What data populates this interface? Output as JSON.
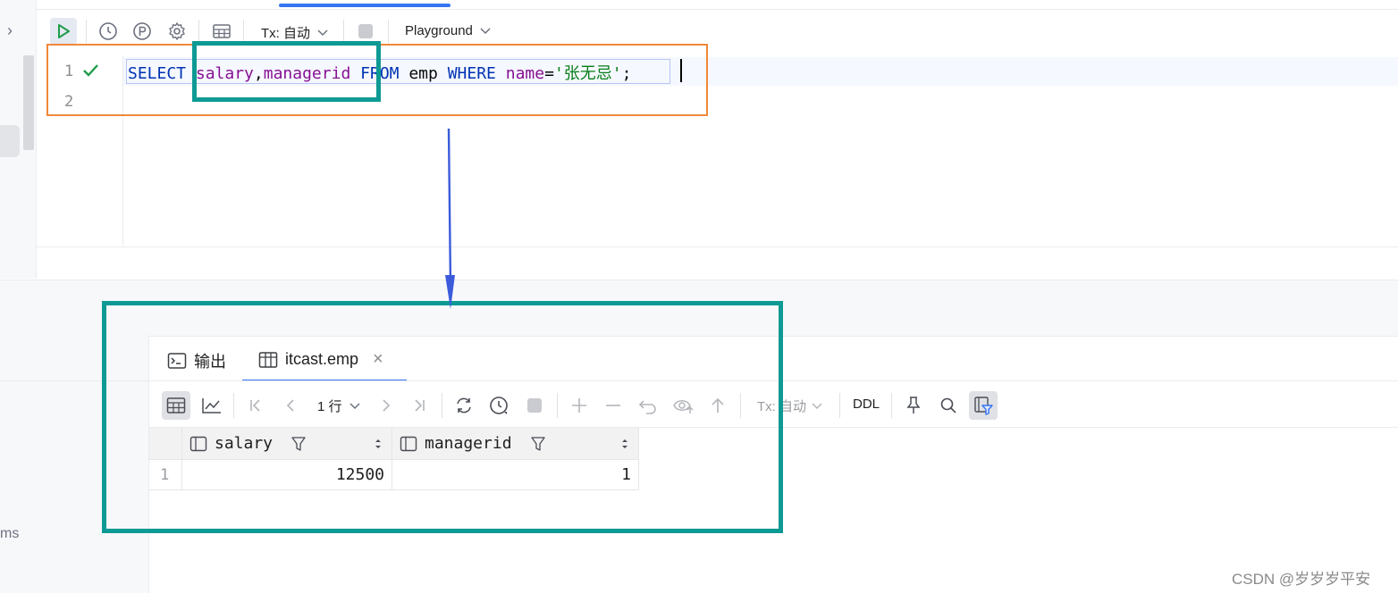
{
  "toolbar": {
    "tx_label": "Tx: 自动",
    "schema_label": "Playground"
  },
  "editor": {
    "line_numbers": [
      "1",
      "2"
    ],
    "code": {
      "kw_select": "SELECT",
      "col_salary": "salary",
      "comma": ",",
      "col_managerid": "managerid",
      "kw_from": "FROM",
      "table": "emp",
      "kw_where": "WHERE",
      "col_name": "name",
      "eq": "=",
      "string": "'张无忌'",
      "semicolon": ";"
    }
  },
  "left_panel": {
    "fragment": "ms"
  },
  "results": {
    "tabs": [
      {
        "label": "输出",
        "icon": "console-icon"
      },
      {
        "label": "itcast.emp",
        "icon": "table-icon"
      }
    ],
    "toolbar": {
      "rows_label": "1 行",
      "tx_label": "Tx: 自动",
      "ddl_label": "DDL"
    },
    "columns": [
      "salary",
      "managerid"
    ],
    "rows": [
      {
        "row_number": "1",
        "cells": [
          "12500",
          "1"
        ]
      }
    ]
  },
  "watermark": "CSDN @岁岁岁平安",
  "colors": {
    "orange_box": "#f0893a",
    "teal_box": "#0e9a94",
    "arrow": "#3b5bdb",
    "keyword": "#0033b3",
    "column": "#871094",
    "string": "#067d17",
    "accent": "#3574f0"
  }
}
